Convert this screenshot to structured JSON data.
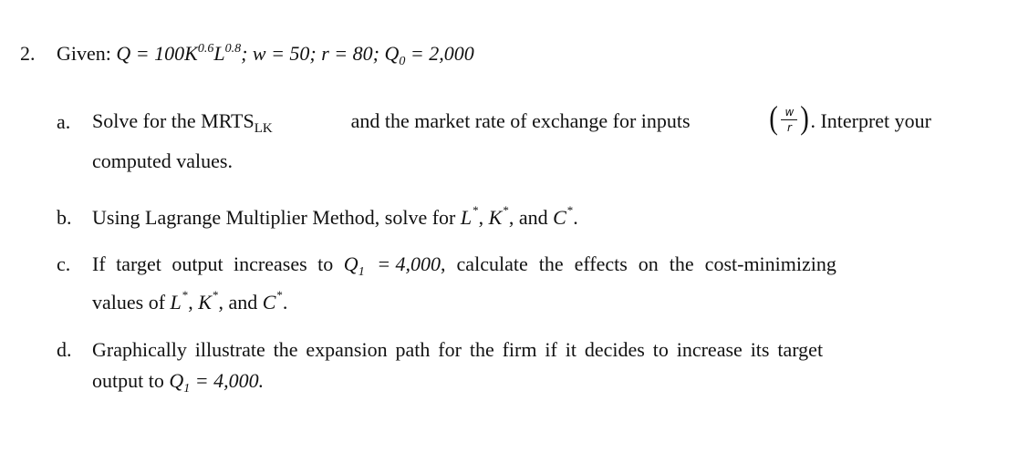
{
  "problem": {
    "number": "2.",
    "given_label": "Given:",
    "equation": {
      "q": "Q",
      "eq1": " = 100K",
      "k_exp": "0.6",
      "l": "L",
      "l_exp": "0.8",
      "sep1": "; w = 50; r = 80; ",
      "q0": "Q",
      "q0_sub": "0",
      "eq2": " = 2,000"
    }
  },
  "items": {
    "a": {
      "label": "a.",
      "line1_part1": "Solve for the MRTS",
      "mrts_sub": "LK",
      "line1_part2": "and the market rate of exchange for inputs",
      "frac_num": "w",
      "frac_den": "r",
      "line1_part3": ". Interpret your",
      "line2": "computed values."
    },
    "b": {
      "label": "b.",
      "text": "Using Lagrange Multiplier Method, solve for ",
      "L": "L",
      "K": "K",
      "C": "C",
      "star": "*",
      "comma": ", ",
      "and": ", and ",
      "end": "."
    },
    "c": {
      "label": "c.",
      "line1_part1": "If target output increases to",
      "q1": "Q",
      "q1_sub": "1",
      "q1_value": "= 4,000",
      "line1_part2": ", calculate the effects on the cost-minimizing",
      "line2_prefix": "values of ",
      "L": "L",
      "K": "K",
      "C": "C",
      "star": "*",
      "comma": ", ",
      "and": ", and ",
      "end": "."
    },
    "d": {
      "label": "d.",
      "line1": "Graphically illustrate the expansion path for the firm if it decides to increase its target",
      "line2_prefix": "output to ",
      "q1": "Q",
      "q1_sub": "1",
      "q1_value": " = 4,000."
    }
  }
}
